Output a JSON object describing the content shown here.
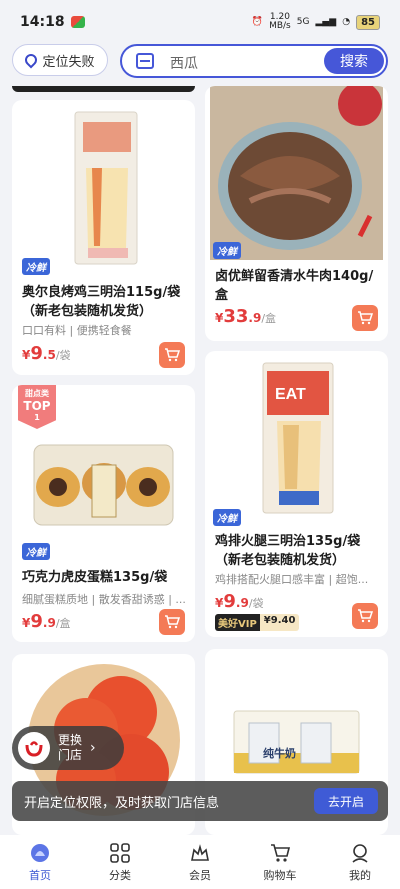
{
  "status_bar": {
    "time": "14:18",
    "network_speed": "1.20\nMB/s",
    "signal": "5G",
    "battery": "85"
  },
  "header": {
    "location_button": "定位失败",
    "search_placeholder": "西瓜",
    "search_button": "搜索"
  },
  "products": [
    {
      "tag": "冷鲜",
      "title": "奥尔良烤鸡三明治115g/袋（新老包装随机发货）",
      "desc": "口口有料 | 便携轻食餐",
      "price_currency": "¥",
      "price_int": "9",
      "price_dec": ".5",
      "price_unit": "/袋",
      "image_alt": "sandwich package"
    },
    {
      "tag": "冷鲜",
      "title": "卤优鲜留香清水牛肉140g/盒",
      "desc": "",
      "price_currency": "¥",
      "price_int": "33",
      "price_dec": ".9",
      "price_unit": "/盒",
      "image_alt": "braised beef slices"
    },
    {
      "tag": "冷鲜",
      "badge_line1": "甜点类",
      "badge_line2": "TOP",
      "badge_line3": "1",
      "title": "巧克力虎皮蛋糕135g/袋",
      "desc": "细腻蛋糕质地 | 散发香甜诱惑 | ...",
      "price_currency": "¥",
      "price_int": "9",
      "price_dec": ".9",
      "price_unit": "/盒",
      "image_alt": "tiger skin cake rolls"
    },
    {
      "tag": "冷鲜",
      "title": "鸡排火腿三明治135g/袋（新老包装随机发货）",
      "desc": "鸡排搭配火腿口感丰富 | 超饱...",
      "price_currency": "¥",
      "price_int": "9",
      "price_dec": ".9",
      "price_unit": "/袋",
      "vip_label": "美好VIP",
      "vip_price": "¥9.40",
      "image_alt": "chicken ham sandwich EAT"
    },
    {
      "image_alt": "tomatoes on plate"
    },
    {
      "image_alt": "milk box package",
      "pack_label": "纯牛奶"
    }
  ],
  "change_store": {
    "line1": "更换",
    "line2": "门店"
  },
  "location_banner": {
    "text": "开启定位权限，及时获取门店信息",
    "button": "去开启"
  },
  "tabs": [
    {
      "label": "首页",
      "icon": "home-icon",
      "active": true
    },
    {
      "label": "分类",
      "icon": "category-icon"
    },
    {
      "label": "会员",
      "icon": "member-icon"
    },
    {
      "label": "购物车",
      "icon": "cart-icon"
    },
    {
      "label": "我的",
      "icon": "profile-icon"
    }
  ],
  "colors": {
    "accent": "#4657d8",
    "price": "#e23c3c",
    "cart_button": "#f47a56",
    "tag": "#3b66d8"
  }
}
